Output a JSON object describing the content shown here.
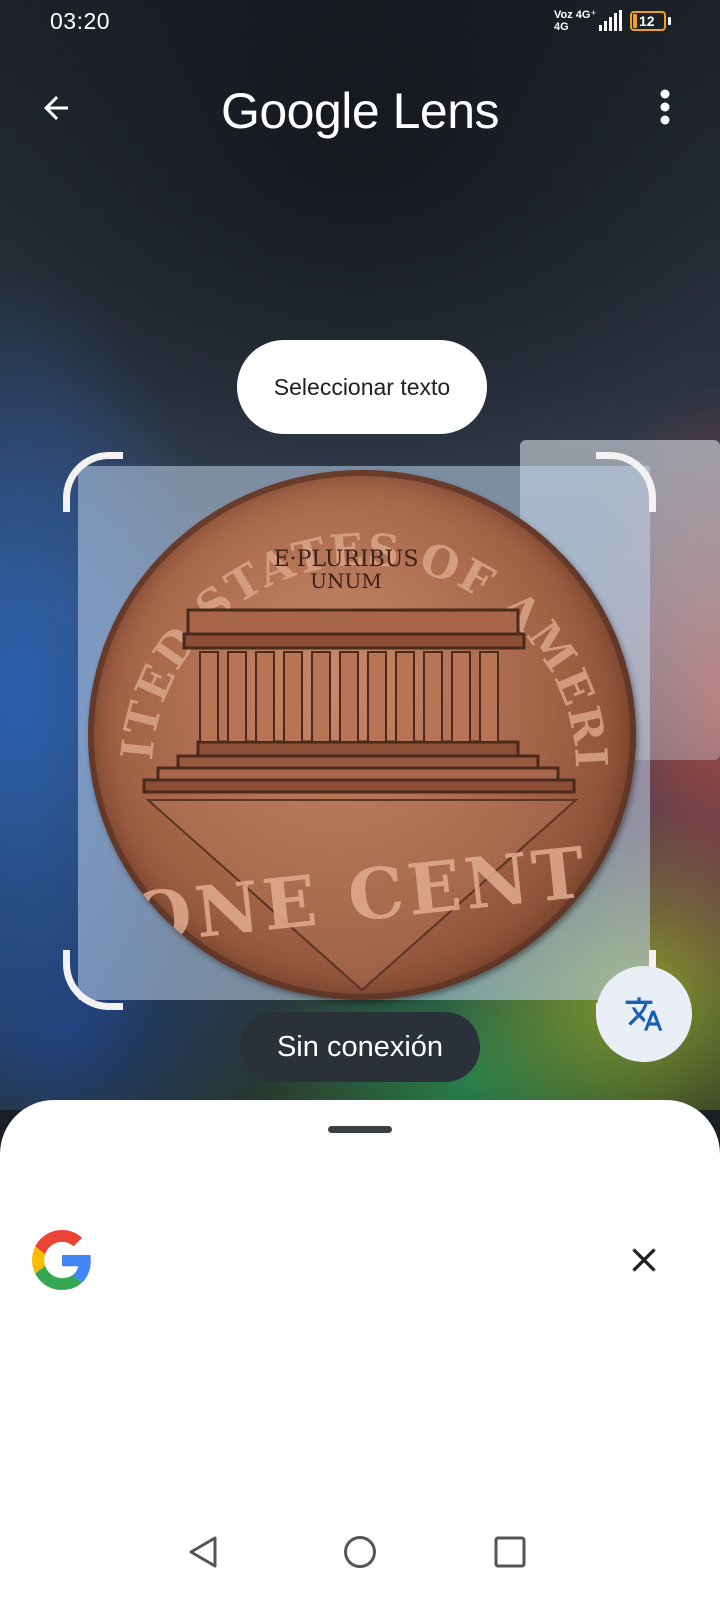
{
  "status_bar": {
    "time": "03:20",
    "network_top": "Voz 4G⁺",
    "network_bottom": "4G",
    "battery_level": "12"
  },
  "app_bar": {
    "title": "Google Lens",
    "back_icon": "arrow-back-icon",
    "menu_icon": "more-vert-icon"
  },
  "overlay": {
    "select_text_label": "Seleccionar texto",
    "offline_label": "Sin conexión",
    "translate_icon": "translate-icon"
  },
  "coin_inscriptions": {
    "top_arc": "UNITED STATES OF AMERICA",
    "motto_line1": "E·PLURIBUS",
    "motto_line2": "UNUM",
    "bottom": "ONE CENT"
  },
  "bottom_sheet": {
    "logo_icon": "google-g-icon",
    "close_icon": "close-icon"
  },
  "nav_bar": {
    "back_icon": "nav-back-triangle-icon",
    "home_icon": "nav-home-circle-icon",
    "recents_icon": "nav-recents-square-icon"
  },
  "colors": {
    "battery_accent": "#f0a020",
    "translate_icon": "#1a5fb4",
    "sheet_background": "#ffffff",
    "offline_chip": "#2b3138"
  }
}
